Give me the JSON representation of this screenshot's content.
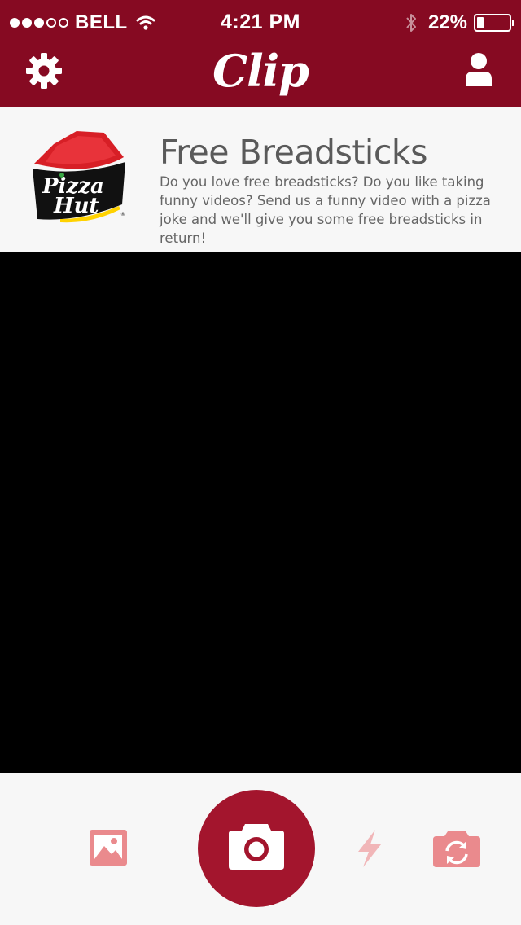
{
  "status_bar": {
    "signal_full": 3,
    "signal_empty": 2,
    "carrier": "BELL",
    "time": "4:21 PM",
    "battery_percent": "22%",
    "battery_level": 0.22
  },
  "nav": {
    "title": "Clip",
    "left_icon": "gear-icon",
    "right_icon": "person-icon"
  },
  "promo": {
    "brand_logo": "Pizza Hut",
    "title": "Free Breadsticks",
    "description": "Do you love free breadsticks? Do you like taking funny videos? Send us a funny video with a pizza joke and we'll give you some free breadsticks in return!"
  },
  "toolbar": {
    "gallery_icon": "image-icon",
    "shutter_icon": "camera-icon",
    "flash_icon": "flash-icon",
    "flip_icon": "camera-flip-icon"
  },
  "colors": {
    "brand": "#860a22",
    "shutter": "#a3152d",
    "icon_accent": "#ea8a8d"
  }
}
